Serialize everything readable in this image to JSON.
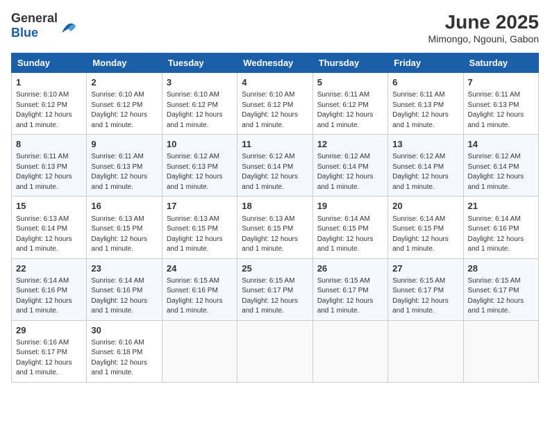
{
  "header": {
    "logo_general": "General",
    "logo_blue": "Blue",
    "month": "June 2025",
    "location": "Mimongo, Ngouni, Gabon"
  },
  "columns": [
    "Sunday",
    "Monday",
    "Tuesday",
    "Wednesday",
    "Thursday",
    "Friday",
    "Saturday"
  ],
  "weeks": [
    [
      {
        "day": "1",
        "info": "Sunrise: 6:10 AM\nSunset: 6:12 PM\nDaylight: 12 hours and 1 minute."
      },
      {
        "day": "2",
        "info": "Sunrise: 6:10 AM\nSunset: 6:12 PM\nDaylight: 12 hours and 1 minute."
      },
      {
        "day": "3",
        "info": "Sunrise: 6:10 AM\nSunset: 6:12 PM\nDaylight: 12 hours and 1 minute."
      },
      {
        "day": "4",
        "info": "Sunrise: 6:10 AM\nSunset: 6:12 PM\nDaylight: 12 hours and 1 minute."
      },
      {
        "day": "5",
        "info": "Sunrise: 6:11 AM\nSunset: 6:12 PM\nDaylight: 12 hours and 1 minute."
      },
      {
        "day": "6",
        "info": "Sunrise: 6:11 AM\nSunset: 6:13 PM\nDaylight: 12 hours and 1 minute."
      },
      {
        "day": "7",
        "info": "Sunrise: 6:11 AM\nSunset: 6:13 PM\nDaylight: 12 hours and 1 minute."
      }
    ],
    [
      {
        "day": "8",
        "info": "Sunrise: 6:11 AM\nSunset: 6:13 PM\nDaylight: 12 hours and 1 minute."
      },
      {
        "day": "9",
        "info": "Sunrise: 6:11 AM\nSunset: 6:13 PM\nDaylight: 12 hours and 1 minute."
      },
      {
        "day": "10",
        "info": "Sunrise: 6:12 AM\nSunset: 6:13 PM\nDaylight: 12 hours and 1 minute."
      },
      {
        "day": "11",
        "info": "Sunrise: 6:12 AM\nSunset: 6:14 PM\nDaylight: 12 hours and 1 minute."
      },
      {
        "day": "12",
        "info": "Sunrise: 6:12 AM\nSunset: 6:14 PM\nDaylight: 12 hours and 1 minute."
      },
      {
        "day": "13",
        "info": "Sunrise: 6:12 AM\nSunset: 6:14 PM\nDaylight: 12 hours and 1 minute."
      },
      {
        "day": "14",
        "info": "Sunrise: 6:12 AM\nSunset: 6:14 PM\nDaylight: 12 hours and 1 minute."
      }
    ],
    [
      {
        "day": "15",
        "info": "Sunrise: 6:13 AM\nSunset: 6:14 PM\nDaylight: 12 hours and 1 minute."
      },
      {
        "day": "16",
        "info": "Sunrise: 6:13 AM\nSunset: 6:15 PM\nDaylight: 12 hours and 1 minute."
      },
      {
        "day": "17",
        "info": "Sunrise: 6:13 AM\nSunset: 6:15 PM\nDaylight: 12 hours and 1 minute."
      },
      {
        "day": "18",
        "info": "Sunrise: 6:13 AM\nSunset: 6:15 PM\nDaylight: 12 hours and 1 minute."
      },
      {
        "day": "19",
        "info": "Sunrise: 6:14 AM\nSunset: 6:15 PM\nDaylight: 12 hours and 1 minute."
      },
      {
        "day": "20",
        "info": "Sunrise: 6:14 AM\nSunset: 6:15 PM\nDaylight: 12 hours and 1 minute."
      },
      {
        "day": "21",
        "info": "Sunrise: 6:14 AM\nSunset: 6:16 PM\nDaylight: 12 hours and 1 minute."
      }
    ],
    [
      {
        "day": "22",
        "info": "Sunrise: 6:14 AM\nSunset: 6:16 PM\nDaylight: 12 hours and 1 minute."
      },
      {
        "day": "23",
        "info": "Sunrise: 6:14 AM\nSunset: 6:16 PM\nDaylight: 12 hours and 1 minute."
      },
      {
        "day": "24",
        "info": "Sunrise: 6:15 AM\nSunset: 6:16 PM\nDaylight: 12 hours and 1 minute."
      },
      {
        "day": "25",
        "info": "Sunrise: 6:15 AM\nSunset: 6:17 PM\nDaylight: 12 hours and 1 minute."
      },
      {
        "day": "26",
        "info": "Sunrise: 6:15 AM\nSunset: 6:17 PM\nDaylight: 12 hours and 1 minute."
      },
      {
        "day": "27",
        "info": "Sunrise: 6:15 AM\nSunset: 6:17 PM\nDaylight: 12 hours and 1 minute."
      },
      {
        "day": "28",
        "info": "Sunrise: 6:15 AM\nSunset: 6:17 PM\nDaylight: 12 hours and 1 minute."
      }
    ],
    [
      {
        "day": "29",
        "info": "Sunrise: 6:16 AM\nSunset: 6:17 PM\nDaylight: 12 hours and 1 minute."
      },
      {
        "day": "30",
        "info": "Sunrise: 6:16 AM\nSunset: 6:18 PM\nDaylight: 12 hours and 1 minute."
      },
      {
        "day": "",
        "info": ""
      },
      {
        "day": "",
        "info": ""
      },
      {
        "day": "",
        "info": ""
      },
      {
        "day": "",
        "info": ""
      },
      {
        "day": "",
        "info": ""
      }
    ]
  ]
}
